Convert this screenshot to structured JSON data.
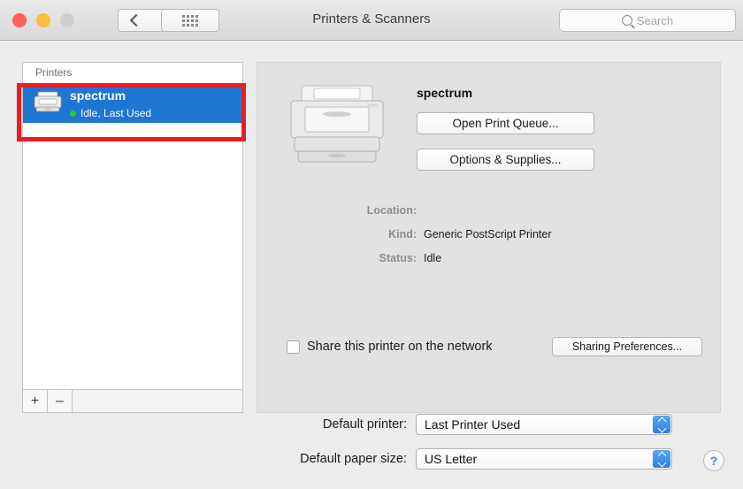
{
  "window": {
    "title": "Printers & Scanners",
    "traffic_lights": [
      "close",
      "minimize",
      "zoom"
    ],
    "nav": {
      "back": "back-chevron",
      "forward": "forward-chevron"
    },
    "show_all_icon": "grid-icon"
  },
  "search": {
    "placeholder": "Search",
    "value": "",
    "icon": "search-icon"
  },
  "sidebar": {
    "header": "Printers",
    "printers": [
      {
        "name": "spectrum",
        "status": "Idle, Last Used",
        "status_color": "#2cc62c",
        "icon": "printer-icon",
        "selected": true
      }
    ],
    "toolbar": {
      "add_label": "+",
      "remove_label": "–"
    }
  },
  "detail": {
    "printer_icon": "printer-icon",
    "name": "spectrum",
    "buttons": {
      "open_queue": "Open Print Queue...",
      "options_supplies": "Options & Supplies..."
    },
    "info": [
      {
        "label": "Location:",
        "value": ""
      },
      {
        "label": "Kind:",
        "value": "Generic PostScript Printer"
      },
      {
        "label": "Status:",
        "value": "Idle"
      }
    ],
    "share": {
      "label": "Share this printer on the network",
      "checked": false,
      "button": "Sharing Preferences..."
    }
  },
  "bottom": {
    "default_printer": {
      "label": "Default printer:",
      "value": "Last Printer Used"
    },
    "default_paper_size": {
      "label": "Default paper size:",
      "value": "US Letter"
    },
    "help_label": "?"
  },
  "annotation": {
    "color": "#ed1c24",
    "target": "spectrum printer row"
  }
}
